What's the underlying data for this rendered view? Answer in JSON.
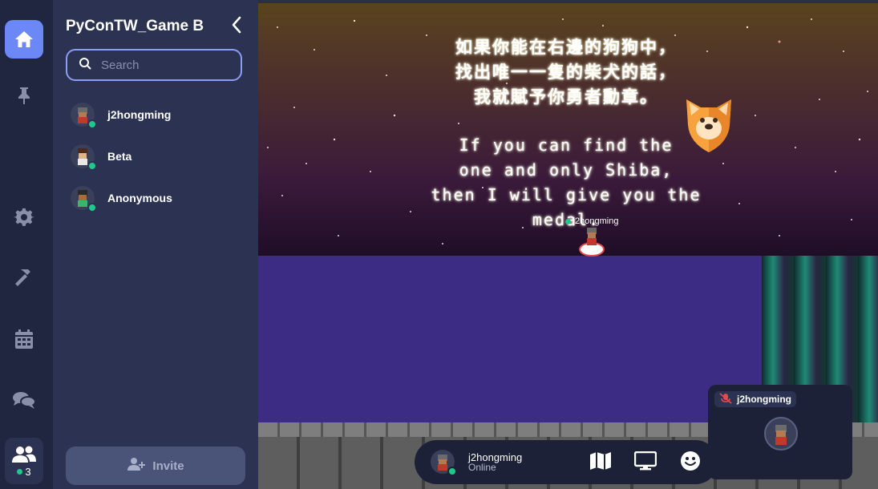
{
  "sidebar_panel": {
    "title": "PyConTW_Game B",
    "search_placeholder": "Search",
    "users": [
      {
        "name": "j2hongming",
        "status": "online"
      },
      {
        "name": "Beta",
        "status": "online"
      },
      {
        "name": "Anonymous",
        "status": "online"
      }
    ],
    "invite_label": "Invite"
  },
  "rail": {
    "icons": [
      "home-icon",
      "pin-icon",
      "gear-icon",
      "hammer-icon",
      "calendar-icon",
      "chat-icon",
      "people-icon"
    ],
    "online_count": "3"
  },
  "game": {
    "message_zh": [
      "如果你能在右邊的狗狗中，",
      "找出唯一一隻的柴犬的話，",
      "我就賦予你勇者勳章。"
    ],
    "message_en": [
      "If you can find the",
      "one and only Shiba,",
      "then I will give you the medal."
    ],
    "player_label": "j2hongming"
  },
  "hud": {
    "name": "j2hongming",
    "status": "Online",
    "icons": [
      "map-icon",
      "screen-share-icon",
      "emoji-icon"
    ]
  },
  "video_tile": {
    "name": "j2hongming",
    "mic": "muted"
  },
  "colors": {
    "accent": "#6c87f6",
    "online": "#1ec98b",
    "panel_bg": "#2b3252",
    "rail_bg": "#202540"
  }
}
